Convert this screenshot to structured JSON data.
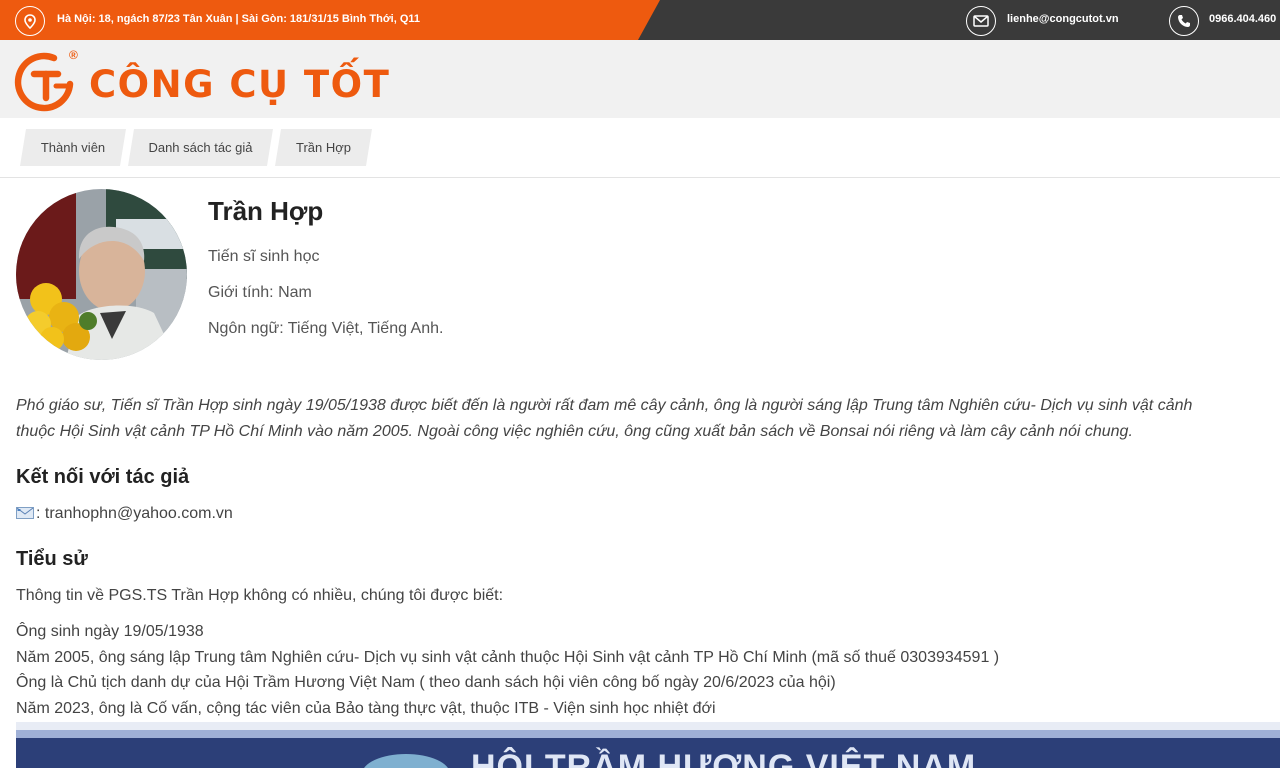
{
  "topbar": {
    "address": "Hà Nội: 18, ngách 87/23 Tân Xuân | Sài Gòn: 181/31/15 Bình Thới, Q11",
    "email": "lienhe@congcutot.vn",
    "phone": "0966.404.460",
    "icons": [
      "location-icon",
      "mail-icon",
      "phone-icon"
    ]
  },
  "brand": {
    "name": "CÔNG CỤ TỐT",
    "registered": "®",
    "color": "#ee5a0f"
  },
  "breadcrumb": [
    "Thành viên",
    "Danh sách tác giả",
    "Trần Hợp"
  ],
  "profile": {
    "name": "Trần Hợp",
    "title": "Tiến sĩ sinh học",
    "gender": "Giới tính: Nam",
    "languages": "Ngôn ngữ: Tiếng Việt, Tiếng Anh."
  },
  "intro": [
    "Phó giáo sư, Tiến sĩ Trần Hợp sinh ngày 19/05/1938 được biết đến là người rất đam mê cây cảnh, ông là người sáng lập Trung tâm Nghiên cứu- Dịch vụ sinh vật cảnh",
    "thuộc Hội Sinh vật cảnh TP Hồ Chí Minh vào năm 2005. Ngoài công việc nghiên cứu, ông cũng xuất bản sách về Bonsai nói riêng và làm cây cảnh nói chung."
  ],
  "connect": {
    "heading": "Kết nối với tác giả",
    "email_line": ": tranhophn@yahoo.com.vn"
  },
  "bio": {
    "heading": "Tiểu sử",
    "lead": "Thông tin về PGS.TS Trần Hợp không có nhiều, chúng tôi được biết:",
    "lines": [
      "Ông sinh ngày 19/05/1938",
      "Năm 2005, ông sáng lập Trung tâm Nghiên cứu- Dịch vụ sinh vật cảnh thuộc Hội Sinh vật cảnh TP Hồ Chí Minh (mã số thuế 0303934591 )",
      "Ông là Chủ tịch danh dự của Hội Trầm Hương Việt Nam ( theo danh sách hội viên công bố ngày 20/6/2023 của hội)",
      "Năm 2023, ông là Cố vấn, cộng tác viên của Bảo tàng thực vật, thuộc ITB - Viện sinh học nhiệt đới"
    ]
  },
  "photo_banner": "HỘI TRẦM HƯƠNG VIỆT NAM"
}
